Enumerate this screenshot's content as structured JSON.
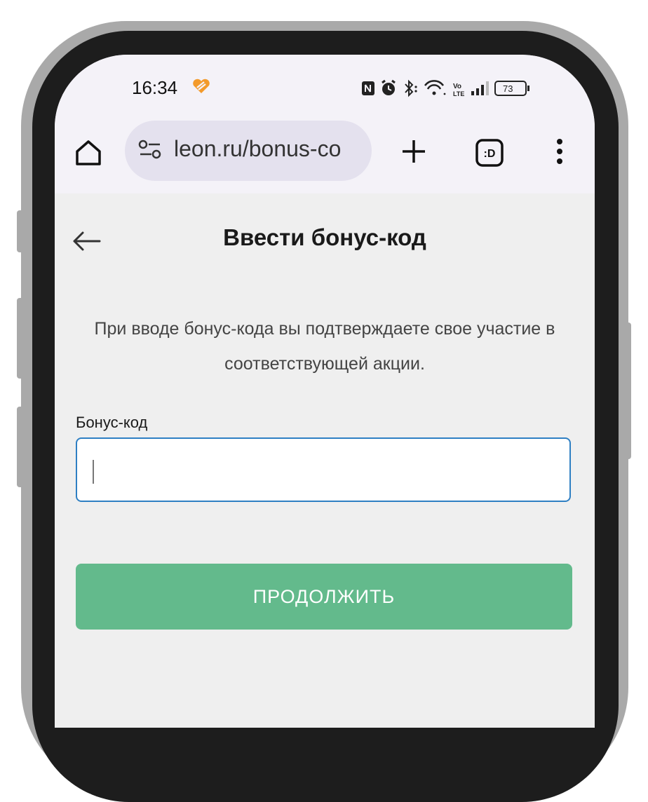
{
  "status_bar": {
    "time": "16:34",
    "battery": "73",
    "icons": [
      "heart-icon",
      "nfc-icon",
      "alarm-icon",
      "bluetooth-icon",
      "wifi-icon",
      "volte-icon",
      "signal-icon",
      "battery-icon"
    ]
  },
  "browser": {
    "url": "leon.ru/bonus-co",
    "icons": [
      "home-icon",
      "site-settings-icon",
      "new-tab-plus-icon",
      "tab-switcher-icon",
      "overflow-menu-icon"
    ],
    "tab_badge": ":D"
  },
  "page": {
    "title": "Ввести бонус-код",
    "info_text": "При вводе бонус-кода вы подтверждаете свое участие в соответствующей акции.",
    "field_label": "Бонус-код",
    "input_value": "",
    "continue_label": "ПРОДОЛЖИТЬ"
  },
  "colors": {
    "accent_green": "#63ba8c",
    "input_border": "#2e7fc3",
    "page_background": "#efefef",
    "browser_chrome": "#f4f2f8",
    "status_heart": "#f39a2b"
  }
}
